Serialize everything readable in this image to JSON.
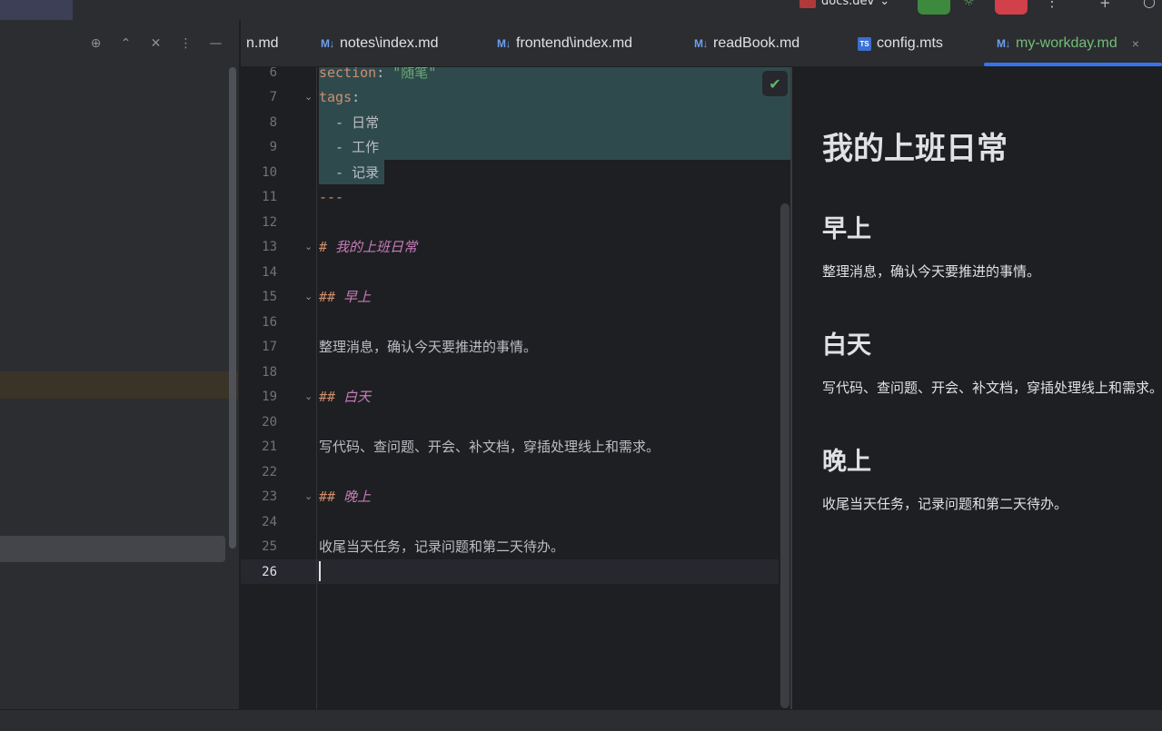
{
  "topbar": {
    "project": "docs.dev",
    "icons": [
      "project-icon",
      "chevron-down-icon",
      "run-icon",
      "debug-icon",
      "stop-icon",
      "more-icon",
      "add-user-icon",
      "search-icon"
    ]
  },
  "left_panel": {
    "tool_icons": [
      "crosshair-icon",
      "expand-icon",
      "collapse-icon",
      "more-icon",
      "minimize-icon"
    ]
  },
  "tabs": [
    {
      "label": "n.md",
      "icon": ""
    },
    {
      "label": "notes\\index.md",
      "icon": "M↓"
    },
    {
      "label": "frontend\\index.md",
      "icon": "M↓"
    },
    {
      "label": "readBook.md",
      "icon": "M↓"
    },
    {
      "label": "config.mts",
      "icon": "TS"
    },
    {
      "label": "my-workday.md",
      "icon": "M↓",
      "active": true,
      "close": "×"
    }
  ],
  "editor": {
    "line_numbers": [
      "6",
      "7",
      "8",
      "9",
      "10",
      "11",
      "12",
      "13",
      "14",
      "15",
      "16",
      "17",
      "18",
      "19",
      "20",
      "21",
      "22",
      "23",
      "24",
      "25",
      "26"
    ],
    "lines": {
      "l6_key": "section",
      "l6_colon": ": ",
      "l6_value": "\"随笔\"",
      "l7_key": "tags",
      "l7_colon": ":",
      "l8": "  - 日常",
      "l9": "  - 工作",
      "l10": "  - 记录",
      "l11": "---",
      "l13_mark": "#",
      "l13_text": " 我的上班日常",
      "l15_mark": "##",
      "l15_text": " 早上",
      "l17": "整理消息，确认今天要推进的事情。",
      "l19_mark": "##",
      "l19_text": " 白天",
      "l21": "写代码、查问题、开会、补文档，穿插处理线上和需求。",
      "l23_mark": "##",
      "l23_text": " 晚上",
      "l25": "收尾当天任务，记录问题和第二天待办。"
    },
    "check_icon": "✔"
  },
  "preview": {
    "h1": "我的上班日常",
    "sections": [
      {
        "heading": "早上",
        "text": "整理消息，确认今天要推进的事情。"
      },
      {
        "heading": "白天",
        "text": "写代码、查问题、开会、补文档，穿插处理线上和需求。"
      },
      {
        "heading": "晚上",
        "text": "收尾当天任务，记录问题和第二天待办。"
      }
    ]
  },
  "colors": {
    "accent": "#3574f0",
    "active_tab_text": "#73bd79",
    "yaml_key": "#cf8e6d",
    "yaml_string": "#6aab73",
    "heading": "#c77dbb",
    "selection": "#2f4a4d"
  }
}
